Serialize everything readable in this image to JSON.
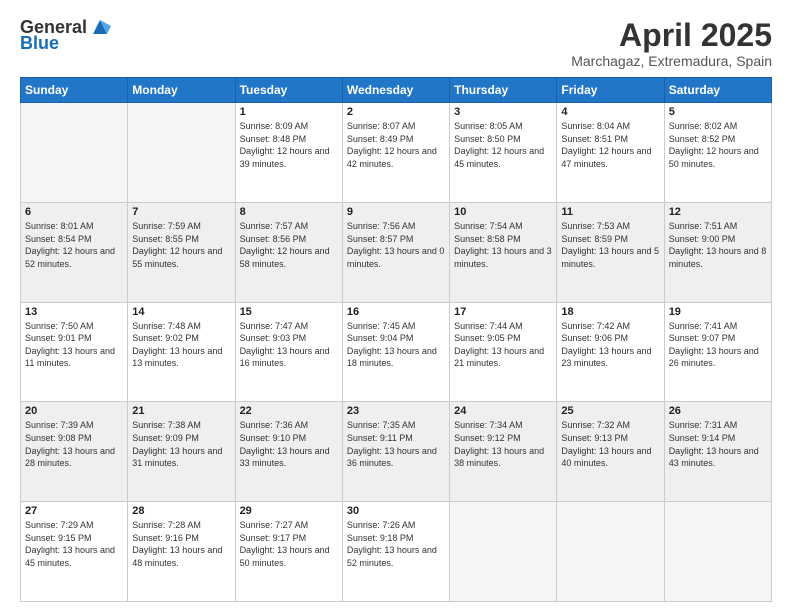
{
  "header": {
    "logo_line1": "General",
    "logo_line2": "Blue",
    "month_year": "April 2025",
    "location": "Marchagaz, Extremadura, Spain"
  },
  "days_of_week": [
    "Sunday",
    "Monday",
    "Tuesday",
    "Wednesday",
    "Thursday",
    "Friday",
    "Saturday"
  ],
  "weeks": [
    [
      {
        "day": "",
        "sunrise": "",
        "sunset": "",
        "daylight": "",
        "empty": true
      },
      {
        "day": "",
        "sunrise": "",
        "sunset": "",
        "daylight": "",
        "empty": true
      },
      {
        "day": "1",
        "sunrise": "Sunrise: 8:09 AM",
        "sunset": "Sunset: 8:48 PM",
        "daylight": "Daylight: 12 hours and 39 minutes.",
        "empty": false
      },
      {
        "day": "2",
        "sunrise": "Sunrise: 8:07 AM",
        "sunset": "Sunset: 8:49 PM",
        "daylight": "Daylight: 12 hours and 42 minutes.",
        "empty": false
      },
      {
        "day": "3",
        "sunrise": "Sunrise: 8:05 AM",
        "sunset": "Sunset: 8:50 PM",
        "daylight": "Daylight: 12 hours and 45 minutes.",
        "empty": false
      },
      {
        "day": "4",
        "sunrise": "Sunrise: 8:04 AM",
        "sunset": "Sunset: 8:51 PM",
        "daylight": "Daylight: 12 hours and 47 minutes.",
        "empty": false
      },
      {
        "day": "5",
        "sunrise": "Sunrise: 8:02 AM",
        "sunset": "Sunset: 8:52 PM",
        "daylight": "Daylight: 12 hours and 50 minutes.",
        "empty": false
      }
    ],
    [
      {
        "day": "6",
        "sunrise": "Sunrise: 8:01 AM",
        "sunset": "Sunset: 8:54 PM",
        "daylight": "Daylight: 12 hours and 52 minutes.",
        "empty": false
      },
      {
        "day": "7",
        "sunrise": "Sunrise: 7:59 AM",
        "sunset": "Sunset: 8:55 PM",
        "daylight": "Daylight: 12 hours and 55 minutes.",
        "empty": false
      },
      {
        "day": "8",
        "sunrise": "Sunrise: 7:57 AM",
        "sunset": "Sunset: 8:56 PM",
        "daylight": "Daylight: 12 hours and 58 minutes.",
        "empty": false
      },
      {
        "day": "9",
        "sunrise": "Sunrise: 7:56 AM",
        "sunset": "Sunset: 8:57 PM",
        "daylight": "Daylight: 13 hours and 0 minutes.",
        "empty": false
      },
      {
        "day": "10",
        "sunrise": "Sunrise: 7:54 AM",
        "sunset": "Sunset: 8:58 PM",
        "daylight": "Daylight: 13 hours and 3 minutes.",
        "empty": false
      },
      {
        "day": "11",
        "sunrise": "Sunrise: 7:53 AM",
        "sunset": "Sunset: 8:59 PM",
        "daylight": "Daylight: 13 hours and 5 minutes.",
        "empty": false
      },
      {
        "day": "12",
        "sunrise": "Sunrise: 7:51 AM",
        "sunset": "Sunset: 9:00 PM",
        "daylight": "Daylight: 13 hours and 8 minutes.",
        "empty": false
      }
    ],
    [
      {
        "day": "13",
        "sunrise": "Sunrise: 7:50 AM",
        "sunset": "Sunset: 9:01 PM",
        "daylight": "Daylight: 13 hours and 11 minutes.",
        "empty": false
      },
      {
        "day": "14",
        "sunrise": "Sunrise: 7:48 AM",
        "sunset": "Sunset: 9:02 PM",
        "daylight": "Daylight: 13 hours and 13 minutes.",
        "empty": false
      },
      {
        "day": "15",
        "sunrise": "Sunrise: 7:47 AM",
        "sunset": "Sunset: 9:03 PM",
        "daylight": "Daylight: 13 hours and 16 minutes.",
        "empty": false
      },
      {
        "day": "16",
        "sunrise": "Sunrise: 7:45 AM",
        "sunset": "Sunset: 9:04 PM",
        "daylight": "Daylight: 13 hours and 18 minutes.",
        "empty": false
      },
      {
        "day": "17",
        "sunrise": "Sunrise: 7:44 AM",
        "sunset": "Sunset: 9:05 PM",
        "daylight": "Daylight: 13 hours and 21 minutes.",
        "empty": false
      },
      {
        "day": "18",
        "sunrise": "Sunrise: 7:42 AM",
        "sunset": "Sunset: 9:06 PM",
        "daylight": "Daylight: 13 hours and 23 minutes.",
        "empty": false
      },
      {
        "day": "19",
        "sunrise": "Sunrise: 7:41 AM",
        "sunset": "Sunset: 9:07 PM",
        "daylight": "Daylight: 13 hours and 26 minutes.",
        "empty": false
      }
    ],
    [
      {
        "day": "20",
        "sunrise": "Sunrise: 7:39 AM",
        "sunset": "Sunset: 9:08 PM",
        "daylight": "Daylight: 13 hours and 28 minutes.",
        "empty": false
      },
      {
        "day": "21",
        "sunrise": "Sunrise: 7:38 AM",
        "sunset": "Sunset: 9:09 PM",
        "daylight": "Daylight: 13 hours and 31 minutes.",
        "empty": false
      },
      {
        "day": "22",
        "sunrise": "Sunrise: 7:36 AM",
        "sunset": "Sunset: 9:10 PM",
        "daylight": "Daylight: 13 hours and 33 minutes.",
        "empty": false
      },
      {
        "day": "23",
        "sunrise": "Sunrise: 7:35 AM",
        "sunset": "Sunset: 9:11 PM",
        "daylight": "Daylight: 13 hours and 36 minutes.",
        "empty": false
      },
      {
        "day": "24",
        "sunrise": "Sunrise: 7:34 AM",
        "sunset": "Sunset: 9:12 PM",
        "daylight": "Daylight: 13 hours and 38 minutes.",
        "empty": false
      },
      {
        "day": "25",
        "sunrise": "Sunrise: 7:32 AM",
        "sunset": "Sunset: 9:13 PM",
        "daylight": "Daylight: 13 hours and 40 minutes.",
        "empty": false
      },
      {
        "day": "26",
        "sunrise": "Sunrise: 7:31 AM",
        "sunset": "Sunset: 9:14 PM",
        "daylight": "Daylight: 13 hours and 43 minutes.",
        "empty": false
      }
    ],
    [
      {
        "day": "27",
        "sunrise": "Sunrise: 7:29 AM",
        "sunset": "Sunset: 9:15 PM",
        "daylight": "Daylight: 13 hours and 45 minutes.",
        "empty": false
      },
      {
        "day": "28",
        "sunrise": "Sunrise: 7:28 AM",
        "sunset": "Sunset: 9:16 PM",
        "daylight": "Daylight: 13 hours and 48 minutes.",
        "empty": false
      },
      {
        "day": "29",
        "sunrise": "Sunrise: 7:27 AM",
        "sunset": "Sunset: 9:17 PM",
        "daylight": "Daylight: 13 hours and 50 minutes.",
        "empty": false
      },
      {
        "day": "30",
        "sunrise": "Sunrise: 7:26 AM",
        "sunset": "Sunset: 9:18 PM",
        "daylight": "Daylight: 13 hours and 52 minutes.",
        "empty": false
      },
      {
        "day": "",
        "sunrise": "",
        "sunset": "",
        "daylight": "",
        "empty": true
      },
      {
        "day": "",
        "sunrise": "",
        "sunset": "",
        "daylight": "",
        "empty": true
      },
      {
        "day": "",
        "sunrise": "",
        "sunset": "",
        "daylight": "",
        "empty": true
      }
    ]
  ]
}
